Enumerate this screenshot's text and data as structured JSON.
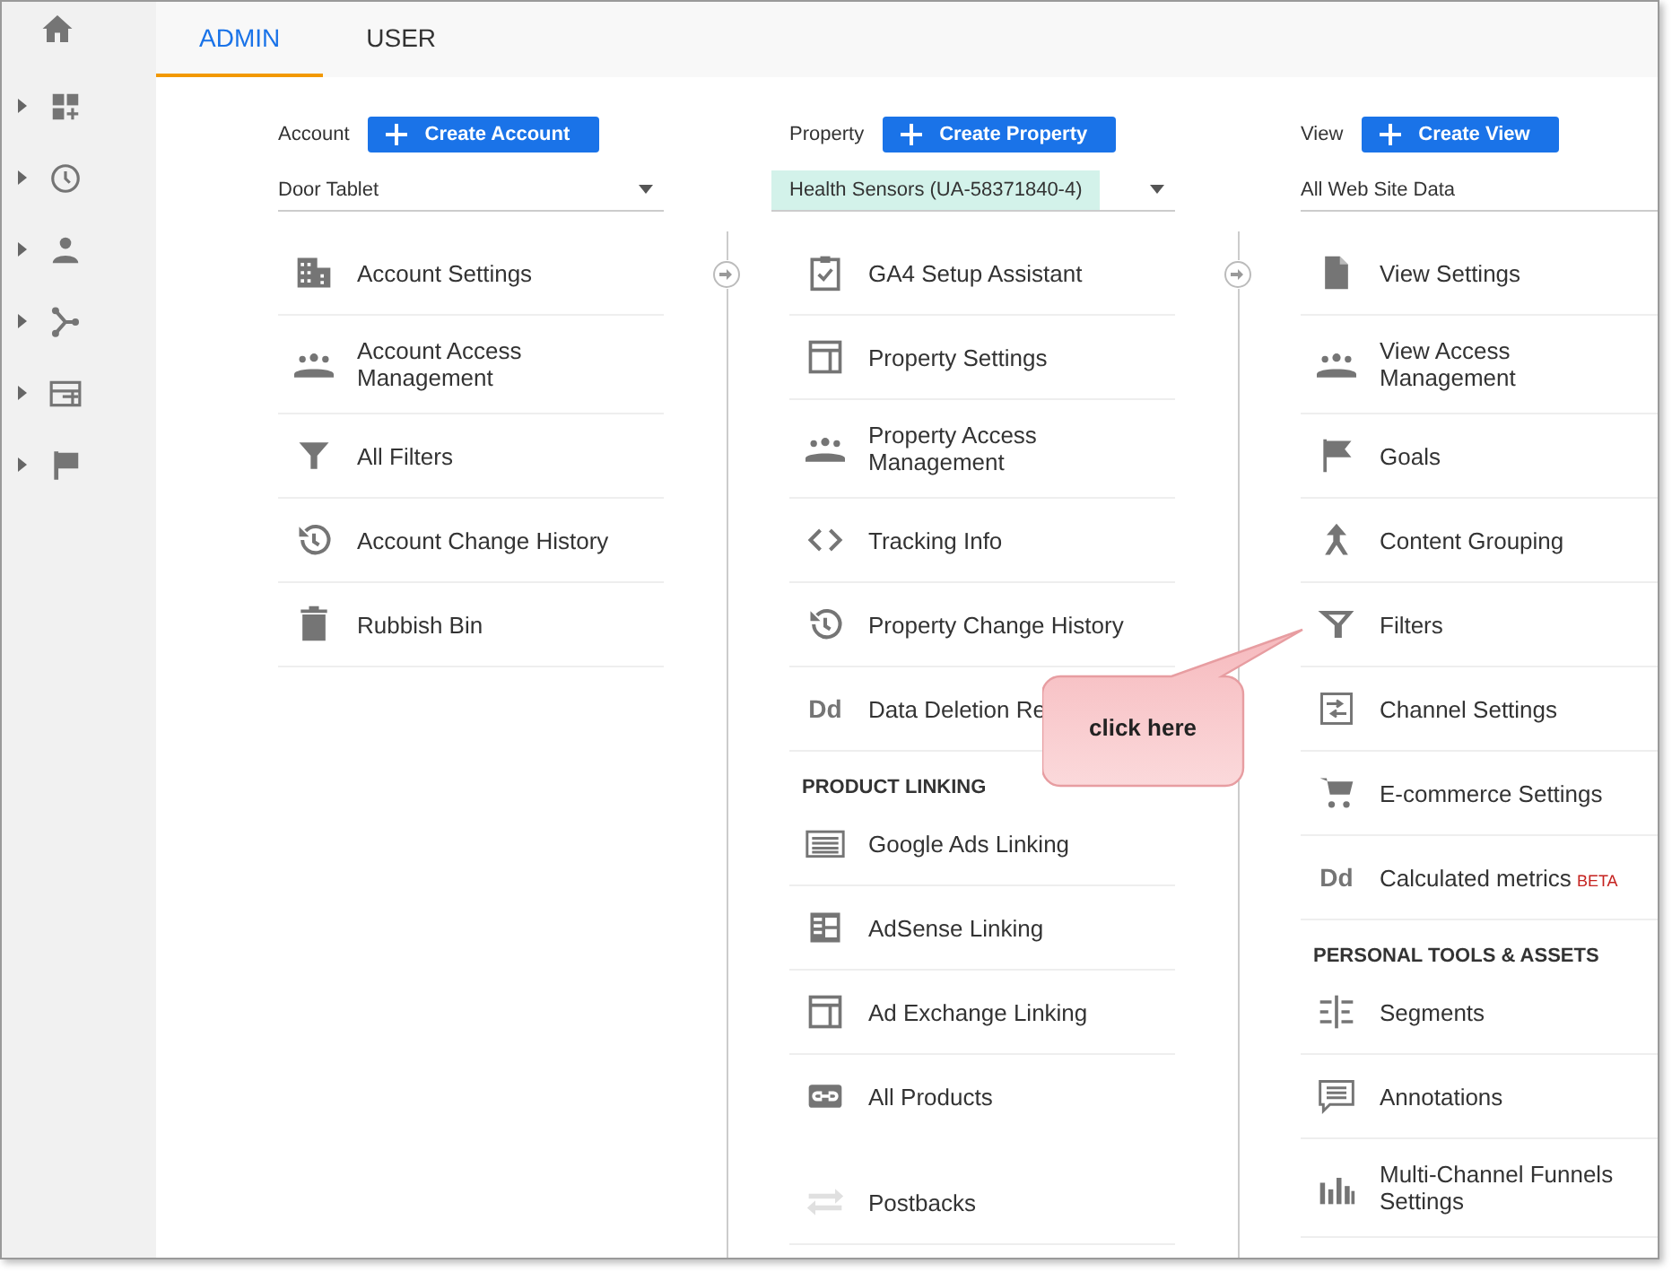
{
  "tabs": [
    {
      "label": "ADMIN",
      "selected": true
    },
    {
      "label": "USER",
      "selected": false
    }
  ],
  "sidebar": {
    "items": [
      {
        "expanded": false
      },
      {
        "expanded": false
      },
      {
        "expanded": false
      },
      {
        "expanded": false
      },
      {
        "expanded": false
      },
      {
        "expanded": false
      }
    ]
  },
  "columns": [
    {
      "label": "Account",
      "button": "Create Account",
      "selector": {
        "value": "Door Tablet",
        "highlighted": false
      },
      "sections": [
        {
          "items": [
            {
              "label": "Account Settings",
              "disabled": false
            },
            {
              "label": "Account Access Management",
              "disabled": false
            },
            {
              "label": "All Filters",
              "disabled": false
            },
            {
              "label": "Account Change History",
              "disabled": false
            },
            {
              "label": "Rubbish Bin",
              "disabled": false
            }
          ]
        }
      ]
    },
    {
      "label": "Property",
      "button": "Create Property",
      "selector": {
        "value": "Health Sensors (UA-58371840-4)",
        "highlighted": true
      },
      "sections": [
        {
          "items": [
            {
              "label": "GA4 Setup Assistant",
              "disabled": false
            },
            {
              "label": "Property Settings",
              "disabled": false
            },
            {
              "label": "Property Access Management",
              "disabled": false
            },
            {
              "label": "Tracking Info",
              "disabled": false
            },
            {
              "label": "Property Change History",
              "disabled": false
            },
            {
              "label": "Data Deletion Re",
              "icon_text": "Dd",
              "disabled": false
            }
          ]
        },
        {
          "heading": "PRODUCT LINKING",
          "items": [
            {
              "label": "Google Ads Linking",
              "disabled": false
            },
            {
              "label": "AdSense Linking",
              "disabled": false
            },
            {
              "label": "Ad Exchange Linking",
              "disabled": false
            },
            {
              "label": "All Products",
              "disabled": false
            }
          ]
        },
        {
          "items": [
            {
              "label": "Postbacks",
              "disabled": true
            }
          ]
        }
      ]
    },
    {
      "label": "View",
      "button": "Create View",
      "selector": {
        "value": "All Web Site Data",
        "highlighted": false
      },
      "sections": [
        {
          "items": [
            {
              "label": "View Settings",
              "disabled": false
            },
            {
              "label": "View Access Management",
              "disabled": false
            },
            {
              "label": "Goals",
              "disabled": false
            },
            {
              "label": "Content Grouping",
              "disabled": false
            },
            {
              "label": "Filters",
              "disabled": false
            },
            {
              "label": "Channel Settings",
              "disabled": false
            },
            {
              "label": "E-commerce Settings",
              "disabled": false
            },
            {
              "label": "Calculated metrics",
              "icon_text": "Dd",
              "badge": "BETA",
              "disabled": false
            }
          ]
        },
        {
          "heading": "PERSONAL TOOLS & ASSETS",
          "items": [
            {
              "label": "Segments",
              "disabled": false
            },
            {
              "label": "Annotations",
              "disabled": false
            },
            {
              "label": "Multi-Channel Funnels Settings",
              "disabled": false
            }
          ]
        }
      ]
    }
  ],
  "callout": {
    "text": "click here"
  }
}
